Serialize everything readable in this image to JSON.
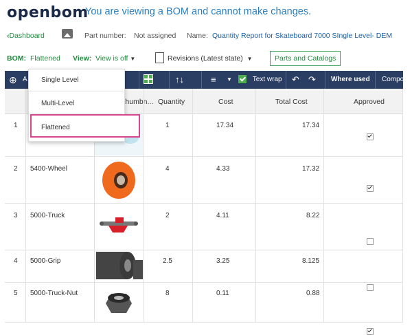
{
  "brand": {
    "logo_text": "openbom",
    "banner_message": "You are viewing a BOM and cannot make changes."
  },
  "breadcrumb": {
    "dashboard_link": "Dashboard",
    "part_number_label": "Part number:",
    "part_number_value": "Not assigned",
    "name_label": "Name:",
    "name_value": "Quantity Report for Skateboard 7000 SIngle Level- DEM"
  },
  "bom_toolbar": {
    "bom_label": "BOM:",
    "bom_value": "Flattened",
    "view_label": "View:",
    "view_value": "View is off",
    "revisions_label": "Revisions (Latest state)",
    "parts_catalogs_button": "Parts and Catalogs"
  },
  "main_toolbar": {
    "add_label": "A",
    "text_wrap_label": "Text wrap",
    "where_used_label": "Where used",
    "compare_label": "Compo"
  },
  "dropdown": {
    "items": [
      "Single Level",
      "Multi-Level",
      "Flattened"
    ],
    "selected": "Flattened"
  },
  "table": {
    "headers": {
      "thumbnail": "Thumbn...",
      "quantity": "Quantity",
      "cost": "Cost",
      "total_cost": "Total Cost",
      "approved": "Approved"
    },
    "rows": [
      {
        "index": "1",
        "part": "",
        "quantity": "1",
        "cost": "17.34",
        "total_cost": "17.34",
        "approved": true
      },
      {
        "index": "2",
        "part": "5400-Wheel",
        "quantity": "4",
        "cost": "4.33",
        "total_cost": "17.32",
        "approved": true
      },
      {
        "index": "3",
        "part": "5000-Truck",
        "quantity": "2",
        "cost": "4.11",
        "total_cost": "8.22",
        "approved": false
      },
      {
        "index": "4",
        "part": "5000-Grip",
        "quantity": "2.5",
        "cost": "3.25",
        "total_cost": "8.125",
        "approved": false
      },
      {
        "index": "5",
        "part": "5000-Truck-Nut",
        "quantity": "8",
        "cost": "0.11",
        "total_cost": "0.88",
        "approved": true
      }
    ]
  },
  "colors": {
    "toolbar_bg": "#2a3d63",
    "link_green": "#208c3d",
    "banner_blue": "#2a7fc1",
    "menu_highlight": "#d9468f"
  }
}
